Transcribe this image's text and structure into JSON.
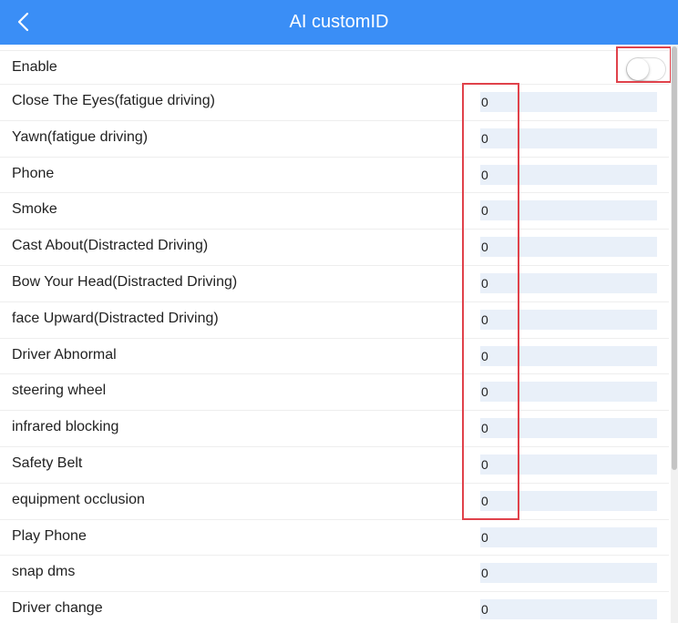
{
  "header": {
    "title": "AI customID",
    "back_icon": "chevron-left-icon",
    "background_color": "#3a8ef6"
  },
  "enable": {
    "label": "Enable",
    "checked": false
  },
  "rows": [
    {
      "label": "Close The Eyes(fatigue driving)",
      "value": "0"
    },
    {
      "label": "Yawn(fatigue driving)",
      "value": "0"
    },
    {
      "label": "Phone",
      "value": "0"
    },
    {
      "label": "Smoke",
      "value": "0"
    },
    {
      "label": "Cast About(Distracted Driving)",
      "value": "0"
    },
    {
      "label": "Bow Your Head(Distracted Driving)",
      "value": "0"
    },
    {
      "label": "face Upward(Distracted Driving)",
      "value": "0"
    },
    {
      "label": "Driver Abnormal",
      "value": "0"
    },
    {
      "label": "steering wheel",
      "value": "0"
    },
    {
      "label": "infrared blocking",
      "value": "0"
    },
    {
      "label": "Safety Belt",
      "value": "0"
    },
    {
      "label": "equipment occlusion",
      "value": "0"
    },
    {
      "label": "Play Phone",
      "value": "0"
    },
    {
      "label": "snap dms",
      "value": "0"
    },
    {
      "label": "Driver change",
      "value": "0"
    }
  ],
  "colors": {
    "input_background": "#e9f0f9",
    "highlight_border": "#e0424b"
  }
}
